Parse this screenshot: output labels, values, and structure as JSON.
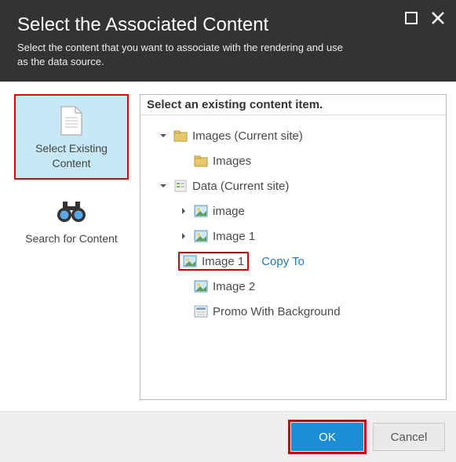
{
  "header": {
    "title": "Select the Associated Content",
    "subtitle": "Select the content that you want to associate with the rendering and use as the data source."
  },
  "leftPanel": {
    "selectExisting": "Select Existing Content",
    "searchFor": "Search for Content"
  },
  "rightPanel": {
    "title": "Select an existing content item.",
    "tree": {
      "imagesCurrentSite": "Images (Current site)",
      "images": "Images",
      "dataCurrentSite": "Data (Current site)",
      "image": "image",
      "image1a": "Image 1",
      "image1b": "Image 1",
      "copyTo": "Copy To",
      "image2": "Image 2",
      "promoBg": "Promo With Background"
    }
  },
  "footer": {
    "ok": "OK",
    "cancel": "Cancel"
  }
}
